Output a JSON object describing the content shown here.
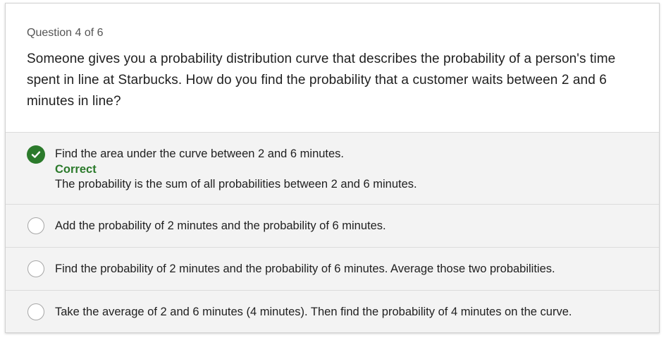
{
  "question": {
    "counter": "Question 4 of 6",
    "text": "Someone gives you a probability distribution curve that describes the probability of a person's time spent in line at Starbucks. How do you find the probability that a customer waits between 2 and 6 minutes in line?"
  },
  "options": [
    {
      "text": "Find the area under the curve between 2 and 6 minutes.",
      "selected": true,
      "feedback_label": "Correct",
      "feedback_text": "The probability is the sum of all probabilities between 2 and 6 minutes.",
      "icon": "checkmark-circle-icon"
    },
    {
      "text": "Add the probability of 2 minutes and the probability of 6 minutes.",
      "selected": false
    },
    {
      "text": "Find the probability of 2 minutes and the probability of 6 minutes. Average those two probabilities.",
      "selected": false
    },
    {
      "text": "Take the average of 2 and 6 minutes (4 minutes). Then find the probability of 4 minutes on the curve.",
      "selected": false
    }
  ],
  "colors": {
    "correct": "#2b7a2b",
    "option_background": "#f3f3f3",
    "divider": "#dcdcdc",
    "radio_border": "#a6a6a6"
  }
}
